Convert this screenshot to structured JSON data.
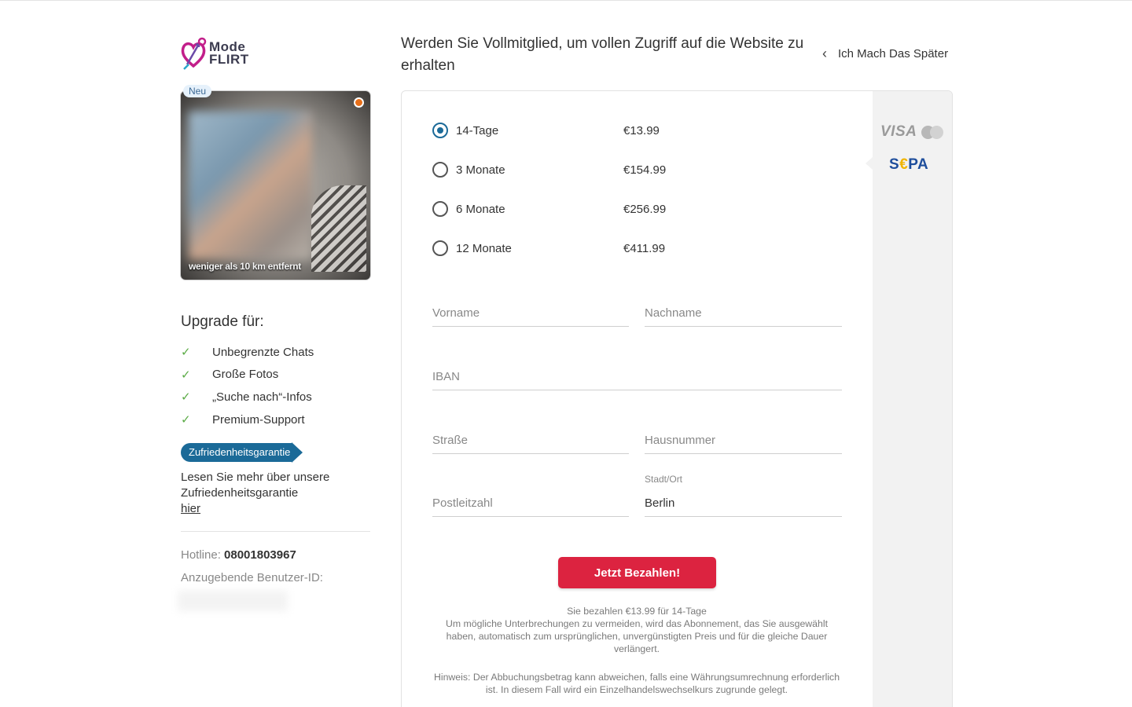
{
  "logo": {
    "line1": "Mode",
    "line2": "FLIRT"
  },
  "profile": {
    "badge": "Neu",
    "distance": "weniger als 10 km entfernt"
  },
  "upgrade": {
    "title": "Upgrade für:",
    "features": [
      "Unbegrenzte Chats",
      "Große Fotos",
      "„Suche nach“-Infos",
      "Premium-Support"
    ]
  },
  "guarantee": {
    "badge": "Zufriedenheitsgarantie",
    "text": "Lesen Sie mehr über unsere Zufriedenheitsgarantie",
    "link": "hier"
  },
  "contact": {
    "hotline_label": "Hotline:",
    "hotline_number": "08001803967",
    "userid_label": "Anzugebende Benutzer-ID:"
  },
  "header": {
    "headline": "Werden Sie Vollmitglied, um vollen Zugriff auf die Website zu erhalten",
    "later": "Ich Mach Das Später"
  },
  "plans": [
    {
      "label": "14-Tage",
      "price": "€13.99",
      "selected": true
    },
    {
      "label": "3 Monate",
      "price": "€154.99",
      "selected": false
    },
    {
      "label": "6 Monate",
      "price": "€256.99",
      "selected": false
    },
    {
      "label": "12 Monate",
      "price": "€411.99",
      "selected": false
    }
  ],
  "payment_methods": {
    "visa": "VISA",
    "sepa_s": "S",
    "sepa_euro": "€",
    "sepa_rest": "PA"
  },
  "form": {
    "firstname_placeholder": "Vorname",
    "lastname_placeholder": "Nachname",
    "iban_placeholder": "IBAN",
    "street_placeholder": "Straße",
    "housenumber_placeholder": "Hausnummer",
    "zip_placeholder": "Postleitzahl",
    "city_label": "Stadt/Ort",
    "city_value": "Berlin"
  },
  "pay_button": "Jetzt Bezahlen!",
  "notice": {
    "summary": "Sie bezahlen €13.99 für 14-Tage",
    "renewal": "Um mögliche Unterbrechungen zu vermeiden, wird das Abonnement, das Sie ausgewählt haben, automatisch zum ursprünglichen, unvergünstigten Preis und für die gleiche Dauer verlängert.",
    "hint": "Hinweis: Der Abbuchungsbetrag kann abweichen, falls eine Währungsumrechnung erforderlich ist. In diesem Fall wird ein Einzelhandelswechselkurs zugrunde gelegt."
  },
  "colors": {
    "accent": "#1b6a98",
    "pay_button": "#dc2340",
    "check": "#5bab46",
    "online": "#e76f1a"
  }
}
